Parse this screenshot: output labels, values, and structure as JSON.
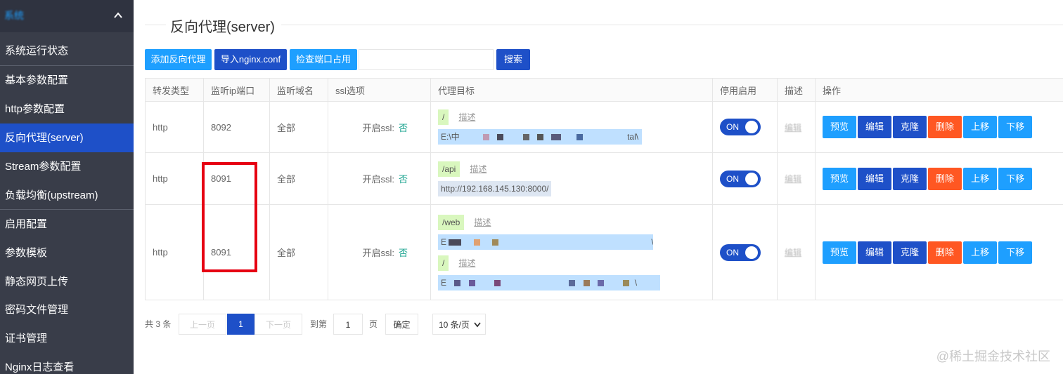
{
  "sidebar": {
    "header": "系统",
    "items": [
      {
        "label": "系统运行状态"
      },
      {
        "label": "基本参数配置"
      },
      {
        "label": "http参数配置"
      },
      {
        "label": "反向代理(server)"
      },
      {
        "label": "Stream参数配置"
      },
      {
        "label": "负载均衡(upstream)"
      },
      {
        "label": "启用配置"
      },
      {
        "label": "参数模板"
      },
      {
        "label": "静态网页上传"
      },
      {
        "label": "密码文件管理"
      },
      {
        "label": "证书管理"
      },
      {
        "label": "Nginx日志查看"
      }
    ],
    "active_index": 3
  },
  "page": {
    "title": "反向代理(server)"
  },
  "toolbar": {
    "add_label": "添加反向代理",
    "import_label": "导入nginx.conf",
    "check_label": "检查端口占用",
    "search_placeholder": "",
    "search_label": "搜索"
  },
  "table": {
    "headers": [
      "转发类型",
      "监听ip端口",
      "监听域名",
      "ssl选项",
      "代理目标",
      "停用启用",
      "描述",
      "操作"
    ],
    "rows": [
      {
        "type": "http",
        "port": "8092",
        "domain": "全部",
        "ssl_label": "开启ssl:",
        "ssl_value": "否",
        "targets": [
          {
            "path": "/",
            "desc": "描述",
            "value": "E:\\中",
            "value_tail": "tal\\"
          }
        ],
        "toggle": "ON",
        "desc": "编辑"
      },
      {
        "type": "http",
        "port": "8091",
        "domain": "全部",
        "ssl_label": "开启ssl:",
        "ssl_value": "否",
        "targets": [
          {
            "path": "/api",
            "desc": "描述",
            "value": "http://192.168.145.130:8000/",
            "value_tail": ""
          }
        ],
        "toggle": "ON",
        "desc": "编辑"
      },
      {
        "type": "http",
        "port": "8091",
        "domain": "全部",
        "ssl_label": "开启ssl:",
        "ssl_value": "否",
        "targets": [
          {
            "path": "/web",
            "desc": "描述",
            "value": "E",
            "value_tail": "\\"
          },
          {
            "path": "/",
            "desc": "描述",
            "value": "E",
            "value_tail": "\\"
          }
        ],
        "toggle": "ON",
        "desc": "编辑"
      }
    ],
    "ops": {
      "preview": "预览",
      "edit": "编辑",
      "clone": "克隆",
      "delete": "删除",
      "up": "上移",
      "down": "下移"
    }
  },
  "pagination": {
    "total": "共 3 条",
    "prev": "上一页",
    "current": "1",
    "next": "下一页",
    "goto": "到第",
    "goto_value": "1",
    "page_unit": "页",
    "confirm": "确定",
    "page_size": "10 条/页"
  },
  "watermark": "@稀土掘金技术社区",
  "colors": {
    "sidebar_bg": "#393d49",
    "active": "#1e50c8",
    "light_btn": "#1e9fff",
    "danger": "#ff5722",
    "highlight": "#e60012"
  }
}
